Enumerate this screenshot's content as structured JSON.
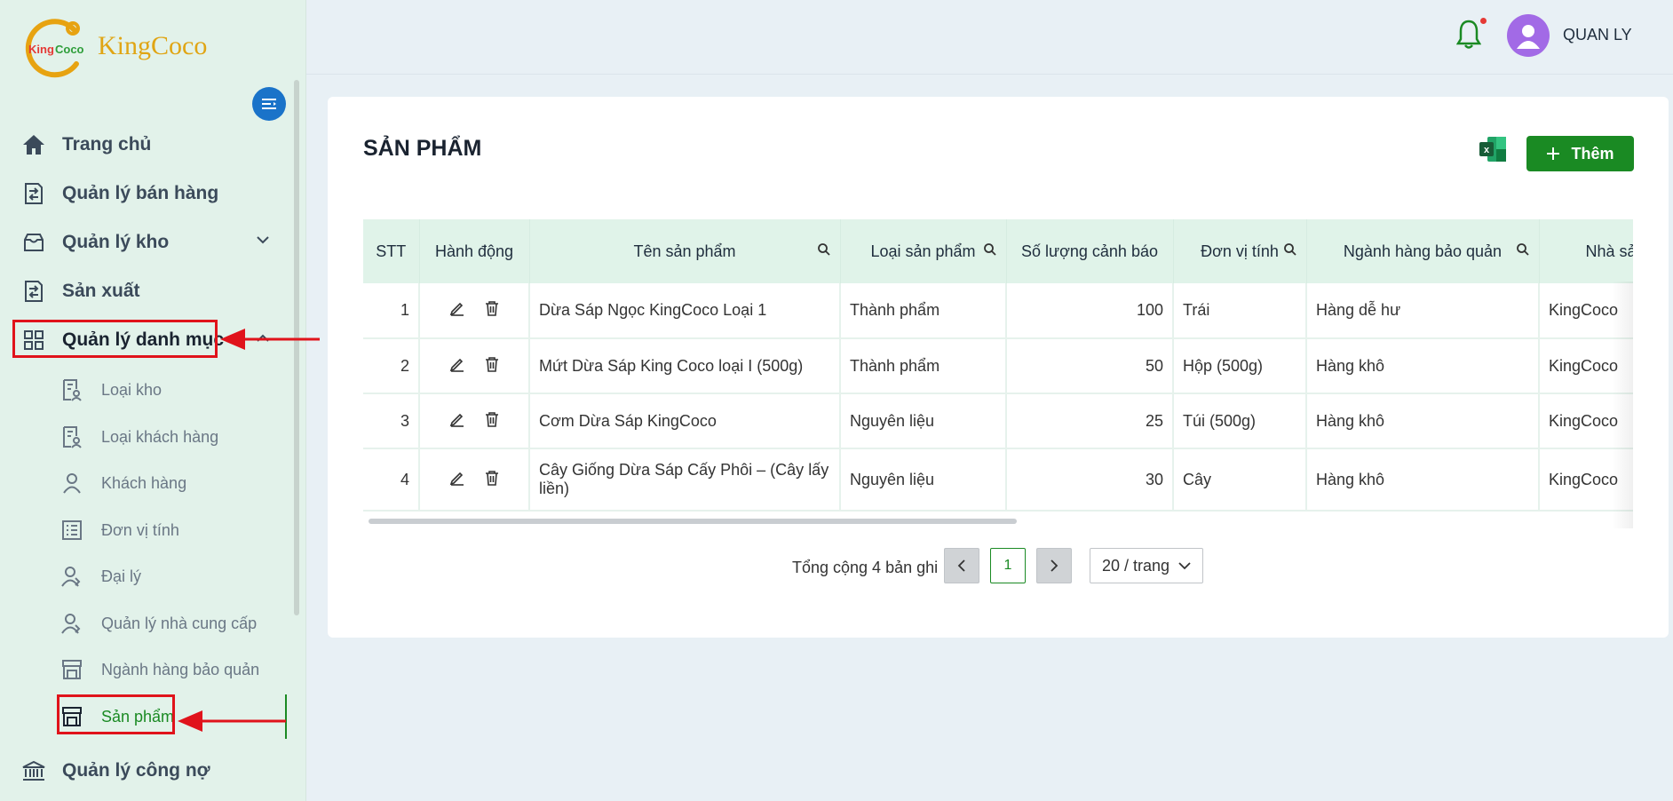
{
  "brand": {
    "name": "KingCoco",
    "logo_text": "KingCoco"
  },
  "header": {
    "username": "QUAN LY"
  },
  "sidebar": {
    "items": [
      {
        "label": "Trang chủ",
        "icon": "home-icon"
      },
      {
        "label": "Quản lý bán hàng",
        "icon": "sales-icon"
      },
      {
        "label": "Quản lý kho",
        "icon": "warehouse-icon"
      },
      {
        "label": "Sản xuất",
        "icon": "production-icon"
      },
      {
        "label": "Quản lý danh mục",
        "icon": "grid-icon"
      },
      {
        "label": "Quản lý công nợ",
        "icon": "bank-icon"
      }
    ],
    "sub_items": [
      {
        "label": "Loại kho"
      },
      {
        "label": "Loại khách hàng"
      },
      {
        "label": "Khách hàng"
      },
      {
        "label": "Đơn vị tính"
      },
      {
        "label": "Đại lý"
      },
      {
        "label": "Quản lý nhà cung cấp"
      },
      {
        "label": "Ngành hàng bảo quản"
      },
      {
        "label": "Sản phẩm"
      }
    ]
  },
  "main": {
    "title": "SẢN PHẨM",
    "add_label": "Thêm",
    "table": {
      "columns": [
        "STT",
        "Hành động",
        "Tên sản phẩm",
        "Loại sản phẩm",
        "Số lượng cảnh báo",
        "Đơn vị tính",
        "Ngành hàng bảo quản",
        "Nhà sả"
      ],
      "rows": [
        {
          "stt": "1",
          "name": "Dừa Sáp Ngọc KingCoco Loại 1",
          "type": "Thành phẩm",
          "qty": "100",
          "unit": "Trái",
          "storage": "Hàng dễ hư",
          "supplier": "KingCoco"
        },
        {
          "stt": "2",
          "name": "Mứt Dừa Sáp King Coco loại I (500g)",
          "type": "Thành phẩm",
          "qty": "50",
          "unit": "Hộp (500g)",
          "storage": "Hàng khô",
          "supplier": "KingCoco"
        },
        {
          "stt": "3",
          "name": "Cơm Dừa Sáp KingCoco",
          "type": "Nguyên liệu",
          "qty": "25",
          "unit": "Túi (500g)",
          "storage": "Hàng khô",
          "supplier": "KingCoco"
        },
        {
          "stt": "4",
          "name": "Cây Giống Dừa Sáp Cấy Phôi – (Cây lấy liền)",
          "type": "Nguyên liệu",
          "qty": "30",
          "unit": "Cây",
          "storage": "Hàng khô",
          "supplier": "KingCoco"
        }
      ]
    },
    "pagination": {
      "total_text": "Tổng cộng 4 bản ghi",
      "current_page": "1",
      "page_size": "20 / trang"
    }
  },
  "colors": {
    "primary_green": "#1a8a23",
    "sidebar_bg": "#e2f2ea",
    "highlight_red": "#e0131b",
    "collapse_blue": "#1a73c9"
  }
}
